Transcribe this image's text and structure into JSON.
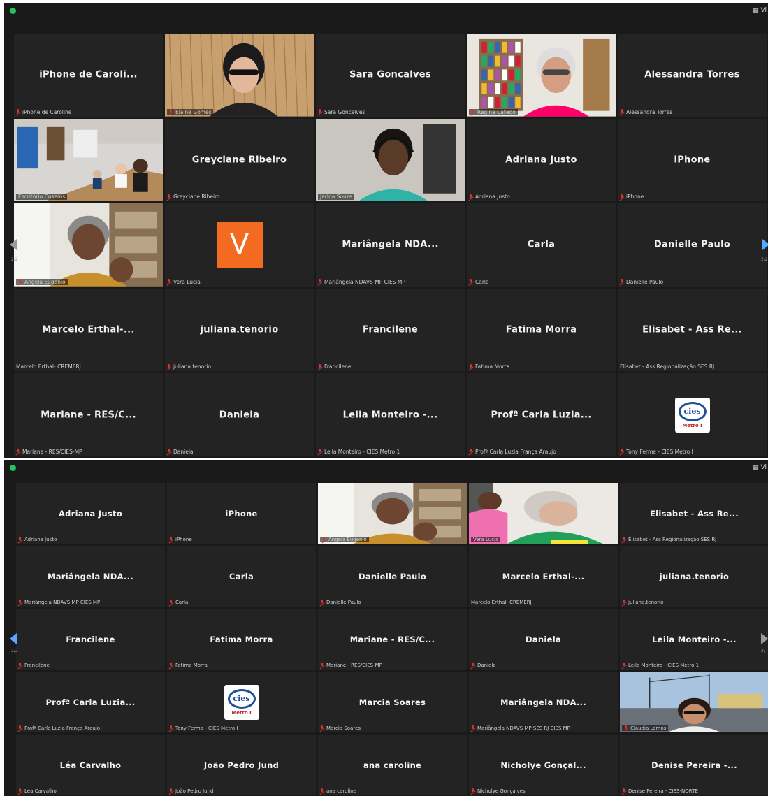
{
  "view_label": "Vi",
  "top": {
    "page_left": "2/2",
    "page_right": "2/2",
    "tiles": [
      {
        "name": "iPhone de Caroli...",
        "label": "iPhone de Caroline",
        "mic": true
      },
      {
        "label": "Elaine Gomes",
        "mic": true,
        "video": "elaine"
      },
      {
        "name": "Sara Goncalves",
        "label": "Sara Goncalves",
        "mic": true
      },
      {
        "label": "Regina Catedo",
        "mic": true,
        "video": "regina"
      },
      {
        "name": "Alessandra Torres",
        "label": "Alessandra Torres",
        "mic": true
      },
      {
        "label": "Escritório Cosems",
        "mic": false,
        "video": "office"
      },
      {
        "name": "Greyciane Ribeiro",
        "label": "Greyciane Ribeiro",
        "mic": true
      },
      {
        "label": "Jarina Souza",
        "mic": false,
        "video": "headset",
        "active": true
      },
      {
        "name": "Adriana Justo",
        "label": "Adriana Justo",
        "mic": true
      },
      {
        "name": "iPhone",
        "label": "iPhone",
        "mic": true
      },
      {
        "label": "Angela Eugenio",
        "mic": true,
        "video": "angela"
      },
      {
        "label": "Vera Lucia",
        "mic": true,
        "avatar": "V"
      },
      {
        "name": "Mariângela NDA...",
        "label": "Mariângela NDAVS MP CIES MP",
        "mic": true
      },
      {
        "name": "Carla",
        "label": "Carla",
        "mic": true
      },
      {
        "name": "Danielle Paulo",
        "label": "Danielle Paulo",
        "mic": true
      },
      {
        "name": "Marcelo Erthal-...",
        "label": "Marcelo Erthal- CREMERJ",
        "mic": false
      },
      {
        "name": "juliana.tenorio",
        "label": "juliana.tenorio",
        "mic": true
      },
      {
        "name": "Francilene",
        "label": "Francilene",
        "mic": true
      },
      {
        "name": "Fatima Morra",
        "label": "Fatima Morra",
        "mic": true
      },
      {
        "name": "Elisabet - Ass Re...",
        "label": "Elisabet - Ass Regionalização SES RJ",
        "mic": false
      },
      {
        "name": "Mariane - RES/C...",
        "label": "Mariane - RES/CIES-MP",
        "mic": true
      },
      {
        "name": "Daniela",
        "label": "Daniela",
        "mic": true
      },
      {
        "name": "Leila Monteiro -...",
        "label": "Leila Monteiro - CIES Metro 1",
        "mic": true
      },
      {
        "name": "Profª Carla Luzia...",
        "label": "Profª Carla Luzia França Araujo",
        "mic": true
      },
      {
        "label": "Tony Ferma - CIES Metro I",
        "mic": true,
        "logo": true
      }
    ]
  },
  "bottom": {
    "page_left": "2/2",
    "page_right": "2/",
    "tiles": [
      {
        "name": "Adriana Justo",
        "label": "Adriana Justo",
        "mic": true
      },
      {
        "name": "iPhone",
        "label": "iPhone",
        "mic": true
      },
      {
        "label": "Angela Eugenio",
        "mic": true,
        "video": "angela"
      },
      {
        "label": "Vera Lucia",
        "mic": false,
        "video": "vera"
      },
      {
        "name": "Elisabet - Ass Re...",
        "label": "Elisabet - Ass Regionalização SES RJ",
        "mic": true
      },
      {
        "name": "Mariângela NDA...",
        "label": "Mariângela NDAVS MP CIES MP",
        "mic": true
      },
      {
        "name": "Carla",
        "label": "Carla",
        "mic": true
      },
      {
        "name": "Danielle Paulo",
        "label": "Danielle Paulo",
        "mic": true
      },
      {
        "name": "Marcelo Erthal-...",
        "label": "Marcelo Erthal- CREMERJ",
        "mic": false
      },
      {
        "name": "juliana.tenorio",
        "label": "juliana.tenorio",
        "mic": true
      },
      {
        "name": "Francilene",
        "label": "Francilene",
        "mic": true
      },
      {
        "name": "Fatima Morra",
        "label": "Fatima Morra",
        "mic": true
      },
      {
        "name": "Mariane - RES/C...",
        "label": "Mariane - RES/CIES-MP",
        "mic": true
      },
      {
        "name": "Daniela",
        "label": "Daniela",
        "mic": true
      },
      {
        "name": "Leila Monteiro -...",
        "label": "Leila Monteiro - CIES Metro 1",
        "mic": true
      },
      {
        "name": "Profª Carla Luzia...",
        "label": "Profª Carla Luzia França Araujo",
        "mic": true
      },
      {
        "label": "Tony Ferma - CIES Metro I",
        "mic": true,
        "logo": true
      },
      {
        "name": "Marcia Soares",
        "label": "Marcia Soares",
        "mic": true
      },
      {
        "name": "Mariângela NDA...",
        "label": "Mariângela NDAVS MP SES RJ CIES MP",
        "mic": true
      },
      {
        "label": "Cláudia Lemos",
        "mic": true,
        "video": "claudia"
      },
      {
        "name": "Léa Carvalho",
        "label": "Léa Carvalho",
        "mic": true
      },
      {
        "name": "João Pedro Jund",
        "label": "João Pedro Jund",
        "mic": true
      },
      {
        "name": "ana caroline",
        "label": "ana caroline",
        "mic": true
      },
      {
        "name": "Nicholye Gonçal...",
        "label": "Nicholye Gonçalves",
        "mic": true
      },
      {
        "name": "Denise Pereira -...",
        "label": "Denise Pereira - CIES-NORTE",
        "mic": true
      }
    ]
  },
  "logo_text": "cies",
  "logo_sub": "Metro I",
  "colors": {
    "panel": "#1a1a1a",
    "tile": "#232323",
    "active_border": "#d9e46a",
    "mic_muted": "#e03131",
    "nav_arrow": "#5aa7ff",
    "avatar_v": "#f26b21"
  }
}
